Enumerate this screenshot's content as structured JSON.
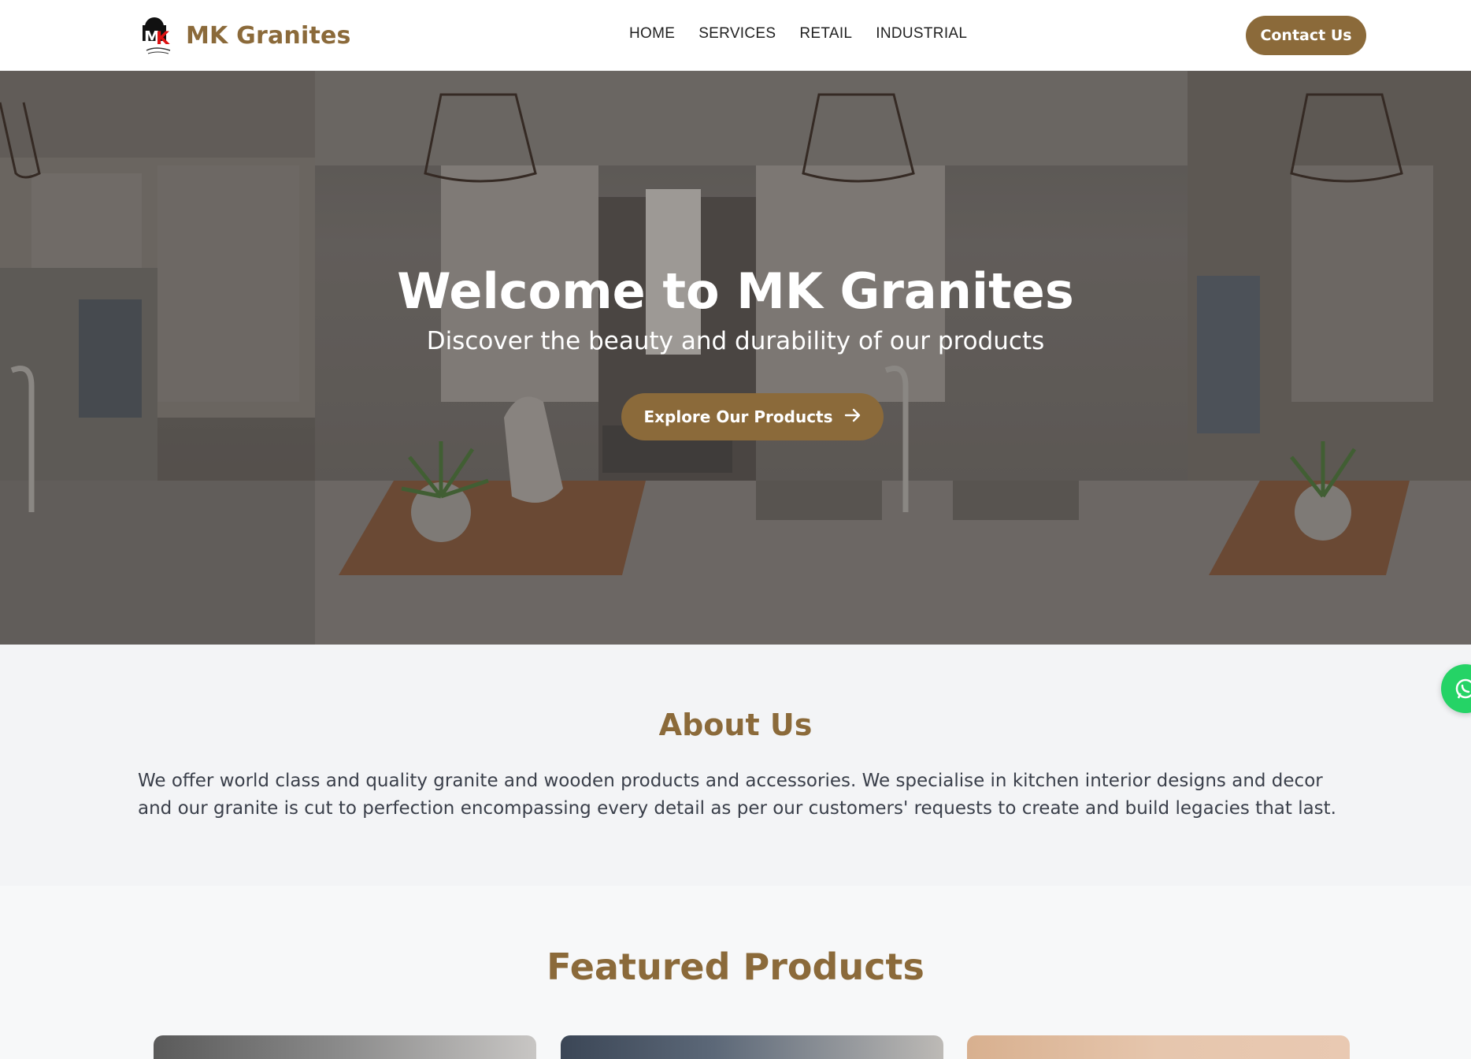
{
  "brand": {
    "name": "MK Granites",
    "accent": "#8b6a3a"
  },
  "nav": {
    "items": [
      "HOME",
      "SERVICES",
      "RETAIL",
      "INDUSTRIAL"
    ]
  },
  "header": {
    "contact_label": "Contact Us"
  },
  "hero": {
    "title": "Welcome to MK Granites",
    "subtitle": "Discover the beauty and durability of our products",
    "cta_label": "Explore Our Products",
    "cta_icon": "arrow-right-icon"
  },
  "about": {
    "title": "About Us",
    "text": "We offer world class and quality granite and wooden products and accessories. We specialise in kitchen interior designs and decor and our granite is cut to perfection encompassing every detail as per our customers' requests to create and build legacies that last."
  },
  "featured": {
    "title": "Featured Products"
  },
  "floating": {
    "icon": "whatsapp-icon",
    "color": "#25d366"
  }
}
